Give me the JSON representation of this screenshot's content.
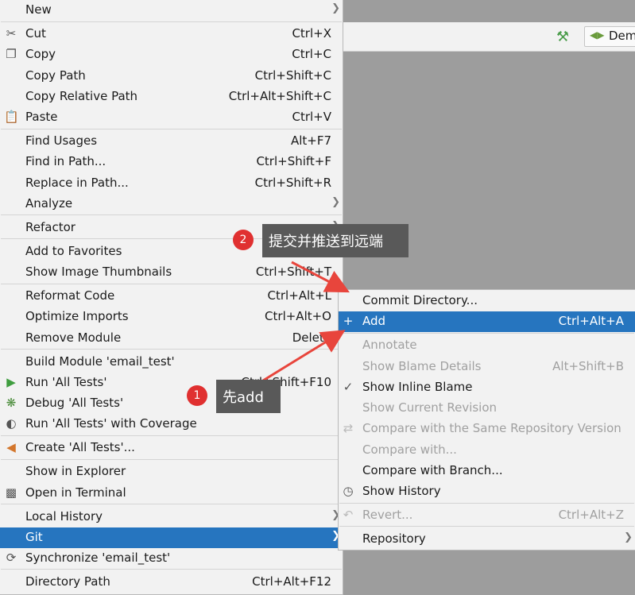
{
  "toolbar": {
    "hammer_icon": "hammer-icon",
    "run_config": "Dem"
  },
  "context_menu": {
    "items": [
      {
        "label": "New",
        "shortcut": "",
        "submenu": true
      },
      {
        "label": "Cut",
        "shortcut": "Ctrl+X",
        "icon": "scissors-icon"
      },
      {
        "label": "Copy",
        "shortcut": "Ctrl+C",
        "icon": "copy-icon"
      },
      {
        "label": "Copy Path",
        "shortcut": "Ctrl+Shift+C"
      },
      {
        "label": "Copy Relative Path",
        "shortcut": "Ctrl+Alt+Shift+C"
      },
      {
        "label": "Paste",
        "shortcut": "Ctrl+V",
        "icon": "clipboard-icon"
      },
      {
        "label": "Find Usages",
        "shortcut": "Alt+F7"
      },
      {
        "label": "Find in Path...",
        "shortcut": "Ctrl+Shift+F"
      },
      {
        "label": "Replace in Path...",
        "shortcut": "Ctrl+Shift+R"
      },
      {
        "label": "Analyze",
        "shortcut": "",
        "submenu": true
      },
      {
        "label": "Refactor",
        "shortcut": "",
        "submenu": true
      },
      {
        "label": "Add to Favorites",
        "shortcut": "",
        "submenu": true
      },
      {
        "label": "Show Image Thumbnails",
        "shortcut": "Ctrl+Shift+T"
      },
      {
        "label": "Reformat Code",
        "shortcut": "Ctrl+Alt+L"
      },
      {
        "label": "Optimize Imports",
        "shortcut": "Ctrl+Alt+O"
      },
      {
        "label": "Remove Module",
        "shortcut": "Delete"
      },
      {
        "label": "Build Module 'email_test'",
        "shortcut": ""
      },
      {
        "label": "Run 'All Tests'",
        "shortcut": "Ctrl+Shift+F10",
        "icon": "run-icon"
      },
      {
        "label": "Debug 'All Tests'",
        "shortcut": "",
        "icon": "debug-icon"
      },
      {
        "label": "Run 'All Tests' with Coverage",
        "shortcut": "",
        "icon": "coverage-icon"
      },
      {
        "label": "Create 'All Tests'...",
        "shortcut": "",
        "icon": "create-test-icon"
      },
      {
        "label": "Show in Explorer",
        "shortcut": ""
      },
      {
        "label": "Open in Terminal",
        "shortcut": "",
        "icon": "terminal-icon"
      },
      {
        "label": "Local History",
        "shortcut": "",
        "submenu": true
      },
      {
        "label": "Git",
        "shortcut": "",
        "submenu": true,
        "highlighted": true
      },
      {
        "label": "Synchronize 'email_test'",
        "shortcut": "",
        "icon": "sync-icon"
      },
      {
        "label": "Directory Path",
        "shortcut": "Ctrl+Alt+F12"
      }
    ]
  },
  "git_submenu": {
    "items": [
      {
        "label": "Commit Directory...",
        "shortcut": ""
      },
      {
        "label": "Add",
        "shortcut": "Ctrl+Alt+A",
        "icon": "plus-icon",
        "highlighted": true
      },
      {
        "label": "Annotate",
        "shortcut": "",
        "disabled": true
      },
      {
        "label": "Show Blame Details",
        "shortcut": "Alt+Shift+B",
        "disabled": true
      },
      {
        "label": "Show Inline Blame",
        "shortcut": "",
        "icon": "check-icon"
      },
      {
        "label": "Show Current Revision",
        "shortcut": "",
        "disabled": true
      },
      {
        "label": "Compare with the Same Repository Version",
        "shortcut": "",
        "disabled": true,
        "icon": "compare-icon"
      },
      {
        "label": "Compare with...",
        "shortcut": "",
        "disabled": true
      },
      {
        "label": "Compare with Branch...",
        "shortcut": ""
      },
      {
        "label": "Show History",
        "shortcut": "",
        "icon": "clock-icon"
      },
      {
        "label": "Revert...",
        "shortcut": "Ctrl+Alt+Z",
        "disabled": true,
        "icon": "revert-icon"
      },
      {
        "label": "Repository",
        "shortcut": "",
        "submenu": true
      }
    ]
  },
  "annotations": {
    "first": {
      "number": "1",
      "text": "先add"
    },
    "second": {
      "number": "2",
      "text": "提交并推送到远端"
    }
  },
  "colors": {
    "highlight": "#2675bf",
    "menu_bg": "#f2f2f2",
    "badge": "#e03030",
    "callout_bg": "#595959",
    "arrow": "#e8453c"
  }
}
